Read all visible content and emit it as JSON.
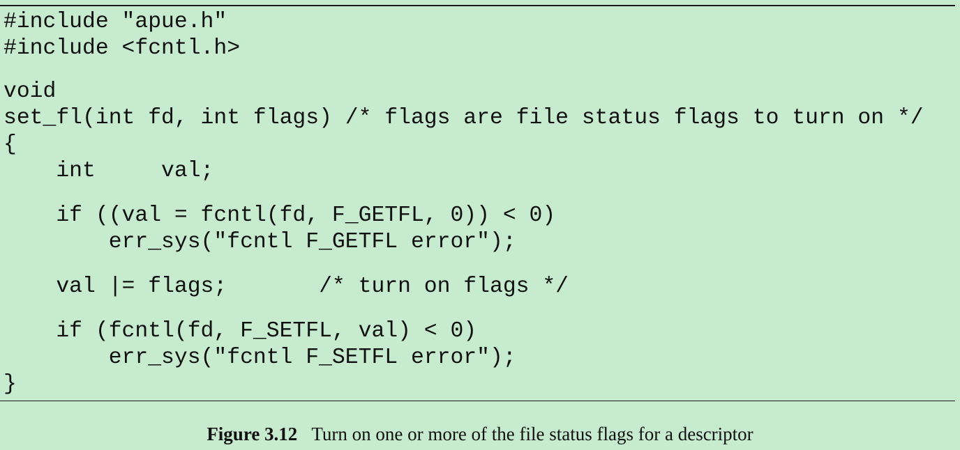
{
  "code": {
    "lines": [
      "#include \"apue.h\"",
      "#include <fcntl.h>",
      "",
      "void",
      "set_fl(int fd, int flags) /* flags are file status flags to turn on */",
      "{",
      "    int     val;",
      "",
      "    if ((val = fcntl(fd, F_GETFL, 0)) < 0)",
      "        err_sys(\"fcntl F_GETFL error\");",
      "",
      "    val |= flags;       /* turn on flags */",
      "",
      "    if (fcntl(fd, F_SETFL, val) < 0)",
      "        err_sys(\"fcntl F_SETFL error\");",
      "}"
    ]
  },
  "caption": {
    "label": "Figure 3.12",
    "text": "Turn on one or more of the file status flags for a descriptor"
  }
}
